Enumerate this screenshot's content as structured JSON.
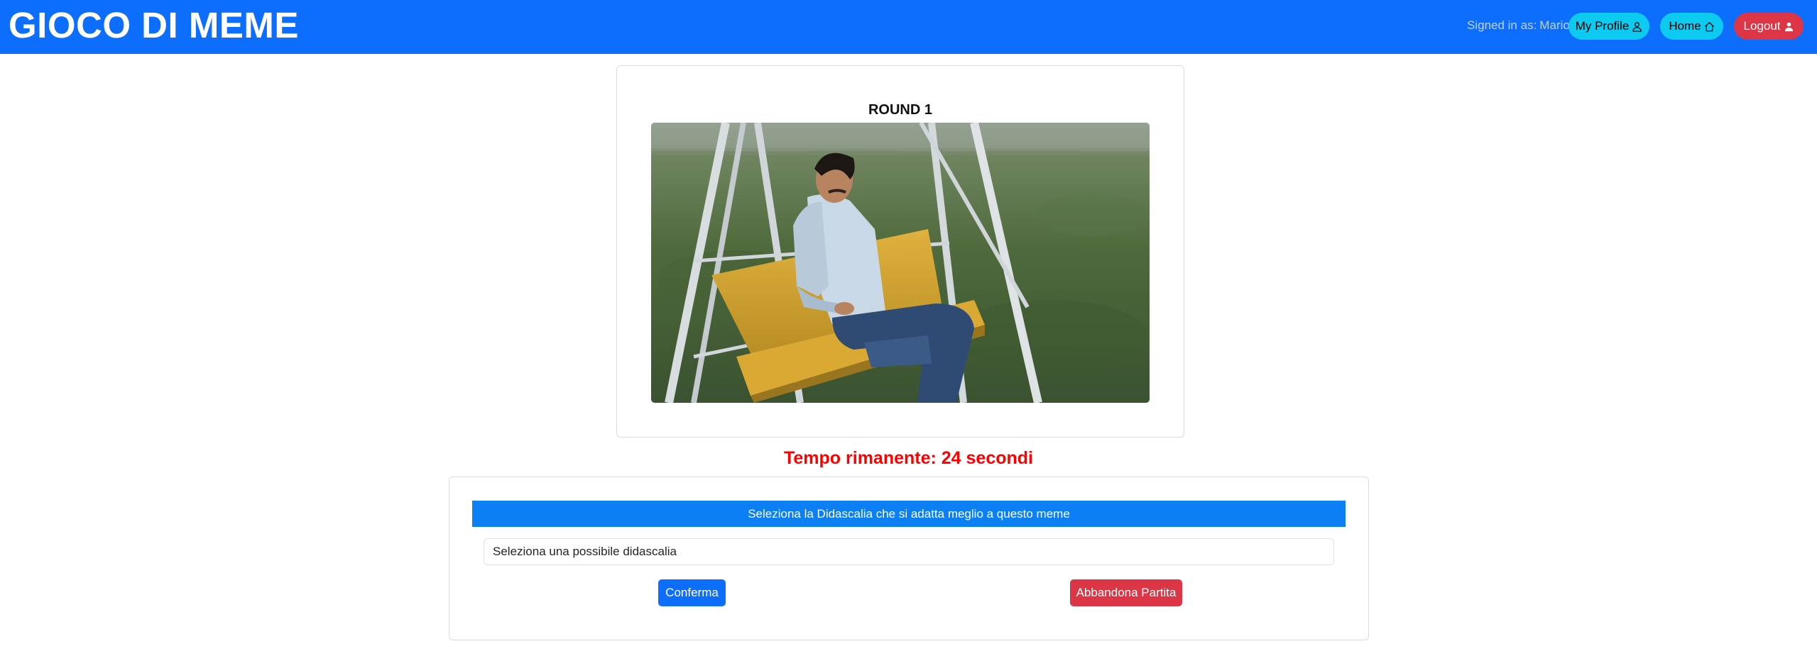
{
  "navbar": {
    "brand": "GIOCO DI MEME",
    "signed_in_label": "Signed in as:",
    "username": "Mario",
    "profile_label": "My Profile",
    "home_label": "Home",
    "logout_label": "Logout",
    "background_color": "#0d6efd"
  },
  "round": {
    "title": "ROUND 1",
    "image_alt": "meme-image-man-sitting-on-yellow-swing-bench"
  },
  "timer": {
    "text": "Tempo rimanente: 24 secondi",
    "color": "#ff0000"
  },
  "caption": {
    "header": "Seleziona la Didascalia che si adatta meglio a questo meme",
    "select_placeholder": "Seleziona una possibile didascalia",
    "confirm_label": "Conferma",
    "abandon_label": "Abbandona Partita"
  },
  "icons": {
    "profile": "person-icon",
    "home": "house-icon",
    "logout": "person-fill-icon"
  },
  "colors": {
    "info": "#0dcaf0",
    "danger": "#dc3545",
    "primary": "#0d6efd"
  }
}
